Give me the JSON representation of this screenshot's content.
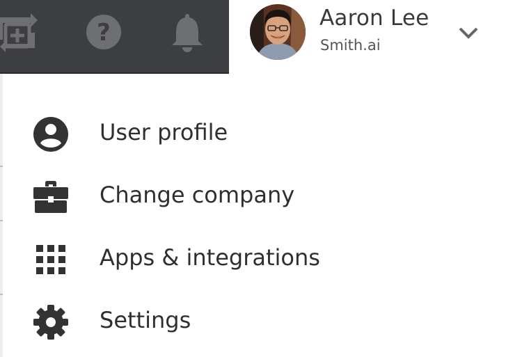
{
  "colors": {
    "topbar": "#3d3e42",
    "topbar_icon": "#6e6f73",
    "menu_icon": "#333333",
    "text": "#2f2f2f"
  },
  "topbar": {
    "icons": [
      "switch-add-icon",
      "help-icon",
      "bell-icon"
    ]
  },
  "user": {
    "name": "Aaron Lee",
    "company": "Smith.ai",
    "avatar": "avatar-photo",
    "toggle_icon": "chevron-down-icon"
  },
  "menu": {
    "items": [
      {
        "label": "User profile",
        "icon": "account-circle-icon"
      },
      {
        "label": "Change company",
        "icon": "briefcase-icon"
      },
      {
        "label": "Apps & integrations",
        "icon": "apps-grid-icon"
      },
      {
        "label": "Settings",
        "icon": "gear-icon"
      }
    ]
  }
}
